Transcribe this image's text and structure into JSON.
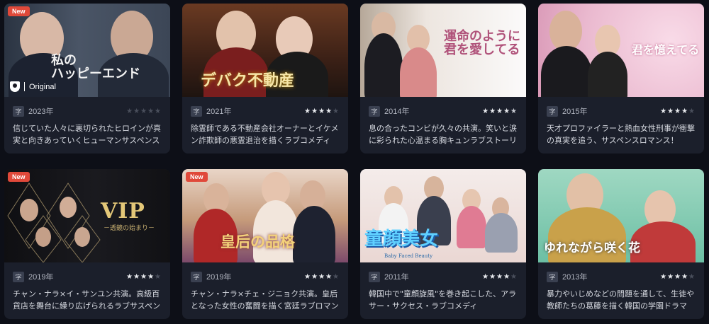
{
  "cards": [
    {
      "badge": "New",
      "art_title": "私の\nハッピーエンド",
      "original_label": "Original",
      "subtitle_icon": "字",
      "year": "2023年",
      "rating": 0,
      "description": "信じていた人々に裏切られたヒロインが真実と向きあっていくヒューマンサスペンス"
    },
    {
      "badge": "",
      "art_title": "デバク不動産",
      "subtitle_icon": "字",
      "year": "2021年",
      "rating": 4,
      "description": "除霊師である不動産会社オーナーとイケメン詐欺師の悪霊退治を描くラブコメディ"
    },
    {
      "badge": "",
      "art_title": "運命のように\n君を愛してる",
      "subtitle_icon": "字",
      "year": "2014年",
      "rating": 4.5,
      "description": "息の合ったコンビが久々の共演。笑いと涙に彩られた心温まる胸キュンラブストーリー"
    },
    {
      "badge": "",
      "art_title": "君を憶えてる",
      "subtitle_icon": "字",
      "year": "2015年",
      "rating": 4,
      "description": "天才プロファイラーと熱血女性刑事が衝撃の真実を追う、サスペンスロマンス！"
    },
    {
      "badge": "New",
      "art_title": "VIP",
      "art_subtitle": "－透鏡の始まり－",
      "subtitle_icon": "字",
      "year": "2019年",
      "rating": 4,
      "description": "チャン・ナラ×イ・サンユン共演。高級百貨店を舞台に繰り広げられるラブサスペンス"
    },
    {
      "badge": "New",
      "art_title": "皇后の品格",
      "subtitle_icon": "字",
      "year": "2019年",
      "rating": 4,
      "description": "チャン・ナラ×チェ・ジニョク共演。皇后となった女性の奮闘を描く宮廷ラブロマンス"
    },
    {
      "badge": "",
      "art_title": "童顔美女",
      "art_subtitle": "Baby Faced Beauty",
      "subtitle_icon": "字",
      "year": "2011年",
      "rating": 4,
      "description": "韓国中で\"童顔旋風\"を巻き起こした、アラサー・サクセス・ラブコメディ"
    },
    {
      "badge": "",
      "art_title": "ゆれながら咲く花",
      "subtitle_icon": "字",
      "year": "2013年",
      "rating": 4,
      "description": "暴力やいじめなどの問題を通して、生徒や教師たちの葛藤を描く韓国の学園ドラマ"
    }
  ],
  "colors": {
    "background": "#0d0f17",
    "card": "#1b1f2b",
    "new_badge": "#e0493a",
    "star_on": "#e9ebef",
    "star_off": "#4a4f5c"
  }
}
